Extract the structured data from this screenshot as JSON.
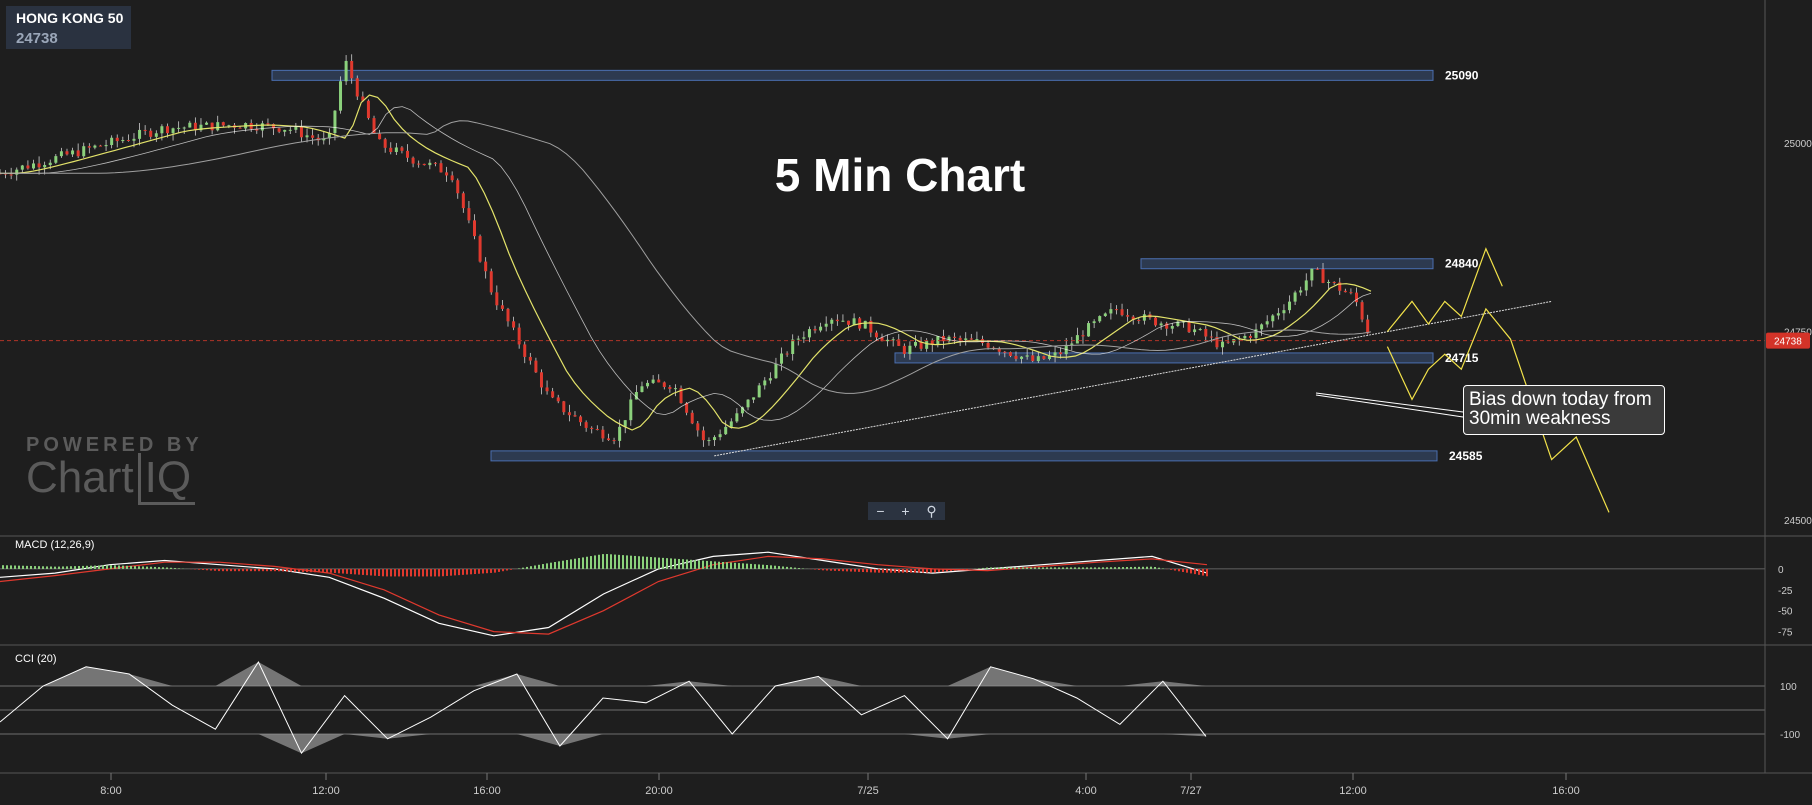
{
  "symbol": {
    "name": "HONG KONG 50",
    "price": "24738"
  },
  "title": "5 Min Chart",
  "annotation": "Bias down today from 30min weakness",
  "watermark": {
    "top": "POWERED BY",
    "chart": "Chart",
    "iq": "IQ"
  },
  "zoom": {
    "minus": "−",
    "plus": "+",
    "magnify": "⚲"
  },
  "colors": {
    "background": "#1e1e1e",
    "bull": "#8bd17c",
    "bear": "#e0392e",
    "zone": "#4a6fb0",
    "ma_fast": "#e3e36a",
    "ma_slow": "#a0a0a0",
    "forecast": "#f2e24a"
  },
  "chart_data": [
    {
      "type": "candlestick",
      "title": "HONG KONG 50 5 Min Chart",
      "x_ticks": [
        "8:00",
        "12:00",
        "16:00",
        "20:00",
        "7/25",
        "4:00",
        "7/27",
        "12:00",
        "16:00"
      ],
      "y_ticks": [
        "25000",
        "24750",
        "24500"
      ],
      "ylim": [
        24480,
        25190
      ],
      "current_price": 24738,
      "levels": [
        {
          "label": "25090",
          "value": 25090
        },
        {
          "label": "24840",
          "value": 24840
        },
        {
          "label": "24715",
          "value": 24715
        },
        {
          "label": "24585",
          "value": 24585
        }
      ],
      "close_path": [
        {
          "x": 0,
          "y": 24960
        },
        {
          "x": 0.5,
          "y": 24975
        },
        {
          "x": 1,
          "y": 24990
        },
        {
          "x": 2,
          "y": 25020
        },
        {
          "x": 3,
          "y": 25025
        },
        {
          "x": 3.5,
          "y": 25020
        },
        {
          "x": 4,
          "y": 25000
        },
        {
          "x": 4.2,
          "y": 25110
        },
        {
          "x": 4.6,
          "y": 25000
        },
        {
          "x": 5,
          "y": 24980
        },
        {
          "x": 5.5,
          "y": 24960
        },
        {
          "x": 6,
          "y": 24800
        },
        {
          "x": 6.7,
          "y": 24660
        },
        {
          "x": 7.2,
          "y": 24620
        },
        {
          "x": 7.5,
          "y": 24610
        },
        {
          "x": 7.8,
          "y": 24680
        },
        {
          "x": 8.2,
          "y": 24680
        },
        {
          "x": 8.6,
          "y": 24600
        },
        {
          "x": 9,
          "y": 24640
        },
        {
          "x": 9.7,
          "y": 24740
        },
        {
          "x": 10.1,
          "y": 24770
        },
        {
          "x": 10.5,
          "y": 24760
        },
        {
          "x": 11,
          "y": 24725
        },
        {
          "x": 11.5,
          "y": 24740
        },
        {
          "x": 12,
          "y": 24735
        },
        {
          "x": 12.6,
          "y": 24710
        },
        {
          "x": 12.9,
          "y": 24720
        },
        {
          "x": 13.2,
          "y": 24750
        },
        {
          "x": 13.6,
          "y": 24780
        },
        {
          "x": 14,
          "y": 24765
        },
        {
          "x": 14.5,
          "y": 24755
        },
        {
          "x": 14.9,
          "y": 24730
        },
        {
          "x": 15.3,
          "y": 24750
        },
        {
          "x": 15.7,
          "y": 24790
        },
        {
          "x": 16.0,
          "y": 24830
        },
        {
          "x": 16.2,
          "y": 24815
        },
        {
          "x": 16.5,
          "y": 24795
        },
        {
          "x": 16.7,
          "y": 24740
        }
      ],
      "forecast_path": [
        {
          "x": 16.9,
          "y": 24750
        },
        {
          "x": 17.2,
          "y": 24790
        },
        {
          "x": 17.4,
          "y": 24760
        },
        {
          "x": 17.6,
          "y": 24790
        },
        {
          "x": 17.8,
          "y": 24770
        },
        {
          "x": 18.1,
          "y": 24860
        },
        {
          "x": 18.3,
          "y": 24810
        }
      ],
      "forecast_path_2": [
        {
          "x": 16.9,
          "y": 24730
        },
        {
          "x": 17.2,
          "y": 24660
        },
        {
          "x": 17.4,
          "y": 24700
        },
        {
          "x": 17.6,
          "y": 24720
        },
        {
          "x": 17.8,
          "y": 24700
        },
        {
          "x": 18.1,
          "y": 24780
        },
        {
          "x": 18.4,
          "y": 24740
        },
        {
          "x": 18.9,
          "y": 24580
        },
        {
          "x": 19.2,
          "y": 24610
        },
        {
          "x": 19.6,
          "y": 24510
        }
      ]
    },
    {
      "type": "line",
      "title": "MACD (12,26,9)",
      "y_ticks": [
        "0",
        "-25",
        "-50",
        "-75"
      ],
      "ylim": [
        -85,
        25
      ],
      "series": [
        {
          "values": [
            -10,
            -5,
            5,
            10,
            5,
            0,
            -10,
            -35,
            -65,
            -80,
            -70,
            -30,
            0,
            15,
            20,
            10,
            0,
            -5,
            0,
            5,
            10,
            15,
            -5
          ]
        },
        {
          "values": [
            -15,
            -8,
            0,
            8,
            8,
            3,
            -5,
            -25,
            -55,
            -75,
            -78,
            -50,
            -15,
            5,
            15,
            12,
            5,
            0,
            -2,
            3,
            8,
            12,
            5
          ]
        }
      ]
    },
    {
      "type": "line",
      "title": "CCI (20)",
      "y_ticks": [
        "100",
        "-100"
      ],
      "ylim": [
        -250,
        250
      ],
      "series": [
        {
          "values": [
            -50,
            100,
            180,
            150,
            20,
            -80,
            200,
            -180,
            60,
            -120,
            -30,
            80,
            150,
            -150,
            50,
            30,
            120,
            -100,
            100,
            140,
            -20,
            60,
            -120,
            180,
            130,
            50,
            -60,
            120,
            -110
          ]
        }
      ]
    }
  ]
}
